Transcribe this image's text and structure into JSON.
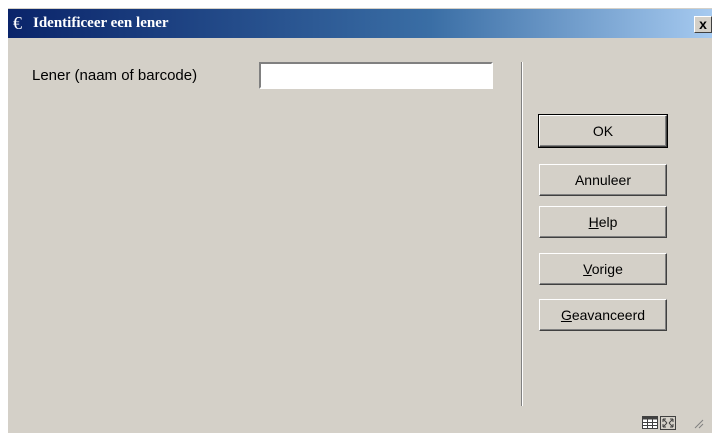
{
  "window": {
    "title": "Identificeer een lener",
    "app_icon_glyph": "€",
    "close_label": "x"
  },
  "form": {
    "label": "Lener (naam of barcode)",
    "value": "",
    "placeholder": ""
  },
  "buttons": [
    {
      "label": "OK",
      "mnemonic_index": -1
    },
    {
      "label": "Annuleer",
      "mnemonic_index": -1
    },
    {
      "label": "Help",
      "mnemonic_index": 0
    },
    {
      "label": "Vorige",
      "mnemonic_index": 0
    },
    {
      "label": "Geavanceerd",
      "mnemonic_index": 0
    }
  ],
  "status_icons": [
    "grid-icon",
    "resize-icon"
  ],
  "colors": {
    "titlebar_start": "#0a246a",
    "titlebar_end": "#a6caf0",
    "dialog_bg": "#d4d0c8"
  }
}
